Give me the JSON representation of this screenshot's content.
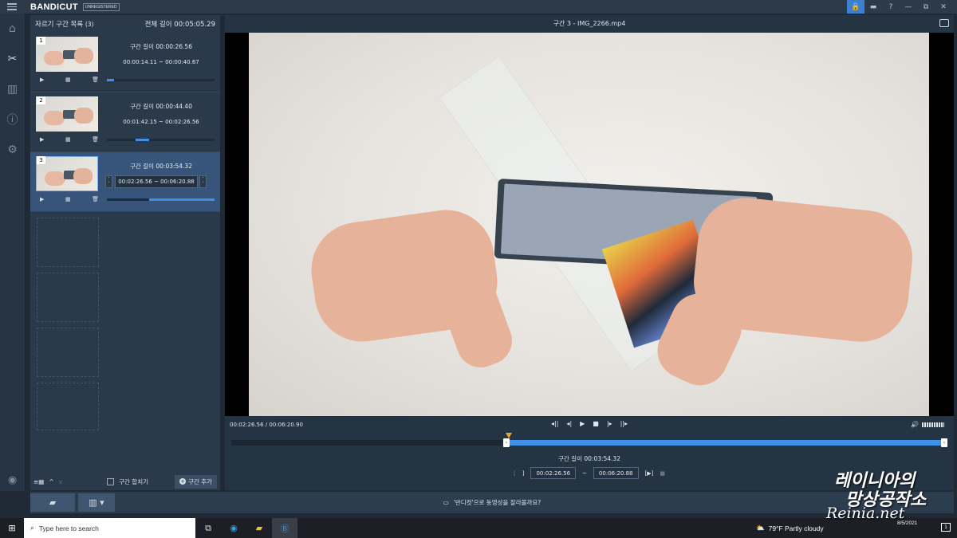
{
  "app": {
    "name": "BANDICUT",
    "badge": "UNREGISTERED"
  },
  "window": {
    "lock_icon": "lock-icon",
    "folder_icon": "folder-icon",
    "help_icon": "help-icon",
    "minimize": "—",
    "restore": "⧉",
    "close": "✕"
  },
  "sidebar": {
    "items": [
      {
        "icon": "home-icon",
        "glyph": "⌂"
      },
      {
        "icon": "cut-icon",
        "glyph": "✂"
      },
      {
        "icon": "film-icon",
        "glyph": "▥"
      },
      {
        "icon": "info-icon",
        "glyph": "ⓘ"
      },
      {
        "icon": "gear-icon",
        "glyph": "⚙"
      }
    ],
    "bottom_icon": "◉"
  },
  "segments_panel": {
    "title": "자르기 구간 목록",
    "count": "(3)",
    "total_label": "전체 길이 00:05:05.29",
    "segments": [
      {
        "num": "1",
        "length": "구간 길이 00:00:26.56",
        "range": "00:00:14.11 ~ 00:00:40.67",
        "progress_start": 0.0,
        "progress_end": 0.07,
        "selected": false
      },
      {
        "num": "2",
        "length": "구간 길이 00:00:44.40",
        "range": "00:01:42.15 ~ 00:02:26.56",
        "progress_start": 0.27,
        "progress_end": 0.39,
        "selected": false
      },
      {
        "num": "3",
        "length": "구간 길이 00:03:54.32",
        "range_start": "00:02:26.56",
        "range_sep": "~",
        "range_end": "00:06:20.88",
        "progress_start": 0.39,
        "progress_end": 1.0,
        "selected": true
      }
    ],
    "footer": {
      "list_icon": "≡▦",
      "up": "^",
      "down": "v",
      "merge_label": "구간 합치기",
      "add_label": "구간 추가"
    }
  },
  "player": {
    "title": "구간 3 - IMG_2266.mp4",
    "time": "00:02:26.56 / 00:06:20.90",
    "transport": [
      "◂||",
      "◂|",
      "▶",
      "■",
      "|▸",
      "||▸"
    ],
    "segment_length": "구간 길이 00:03:54.32",
    "range_start": "00:02:26.56",
    "range_sep": "~",
    "range_end": "00:06:20.88",
    "selection": {
      "start": 0.385,
      "end": 1.0
    }
  },
  "bottom": {
    "tip": "'반디컷'으로 동영상을 잘라볼까요?"
  },
  "taskbar": {
    "search_placeholder": "Type here to search",
    "weather": "79°F  Partly cloudy",
    "time": "8/5/2021"
  },
  "watermark": {
    "line1": "레이니아의",
    "line2": "망상공작소",
    "line3": "Reinia.net"
  }
}
